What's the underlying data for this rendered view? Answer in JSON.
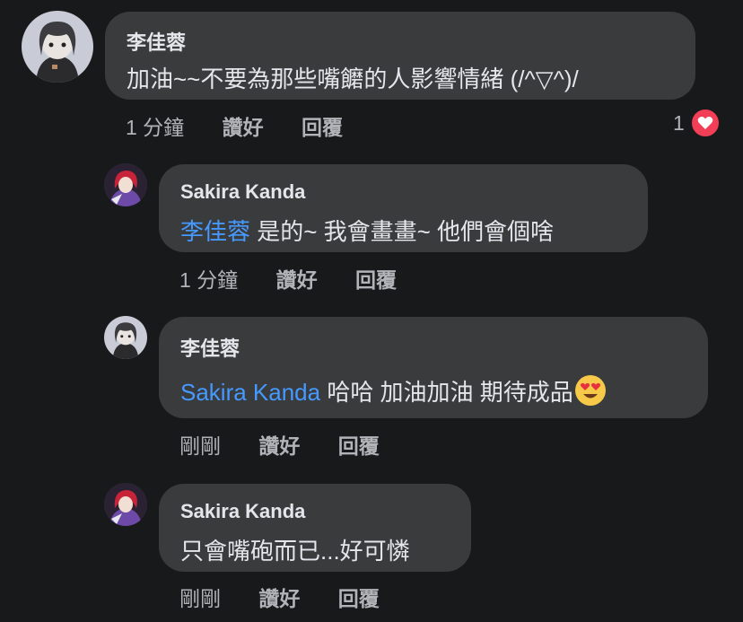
{
  "comments": [
    {
      "author": "李佳蓉",
      "text": "加油~~不要為那些嘴饝的人影響情緒 (/^▽^)/",
      "time": "1 分鐘",
      "like": "讚好",
      "reply": "回覆",
      "reaction_count": "1",
      "reaction": "heart-love"
    },
    {
      "author": "Sakira Kanda",
      "mention": "李佳蓉",
      "text": " 是的~ 我會畫畫~ 他們會個啥",
      "time": "1 分鐘",
      "like": "讚好",
      "reply": "回覆"
    },
    {
      "author": "李佳蓉",
      "mention": "Sakira Kanda",
      "text": " 哈哈  加油加油  期待成品",
      "time": "剛剛",
      "like": "讚好",
      "reply": "回覆"
    },
    {
      "author": "Sakira Kanda",
      "text": "只會嘴砲而已...好可憐",
      "time": "剛剛",
      "like": "讚好",
      "reply": "回覆"
    }
  ],
  "colors": {
    "background": "#18191a",
    "bubble": "#3a3b3c",
    "mention": "#4599ff",
    "heart": "#f33e58"
  }
}
